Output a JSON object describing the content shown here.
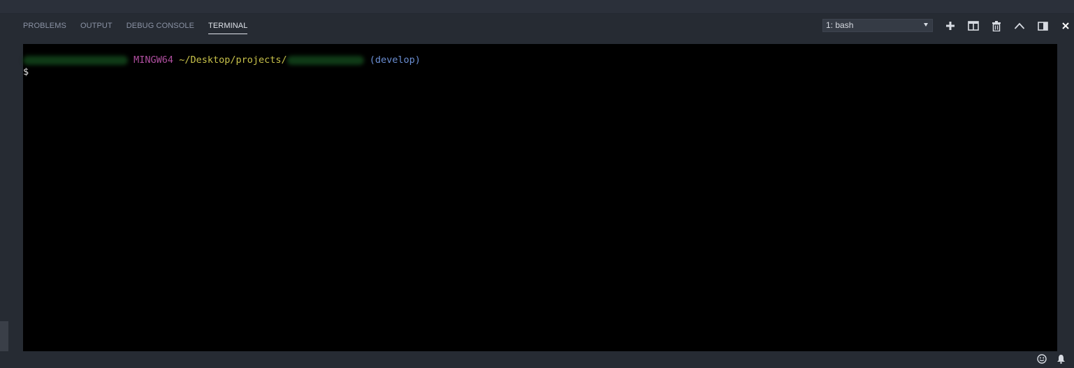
{
  "panel": {
    "tabs": [
      {
        "label": "PROBLEMS",
        "active": false
      },
      {
        "label": "OUTPUT",
        "active": false
      },
      {
        "label": "DEBUG CONSOLE",
        "active": false
      },
      {
        "label": "TERMINAL",
        "active": true
      }
    ],
    "terminal_selector": {
      "selected": "1: bash"
    },
    "actions": [
      "plus-icon",
      "split-icon",
      "trash-icon",
      "chevron-up-icon",
      "panel-layout-icon",
      "close-icon"
    ]
  },
  "terminal": {
    "prompt": {
      "host": "MINGW64",
      "path": "~/Desktop/projects/",
      "branch": "(develop)"
    },
    "input_prompt": "$"
  },
  "status_bar": {
    "icons": [
      "smiley-icon",
      "bell-icon"
    ]
  },
  "colors": {
    "panel_bg": "#262b33",
    "terminal_bg": "#000000",
    "host": "#b04fa0",
    "path": "#c8c24a",
    "branch": "#6b8fd4"
  }
}
